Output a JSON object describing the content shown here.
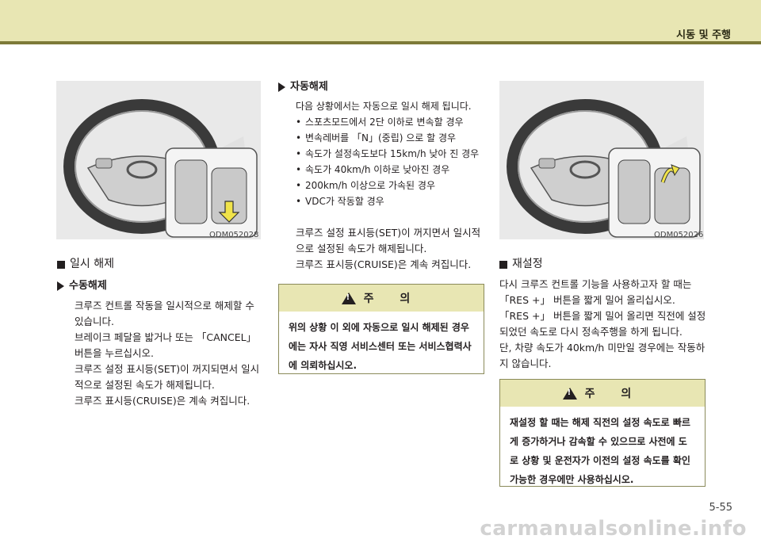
{
  "header": {
    "title": "시동 및 주행"
  },
  "figures": {
    "left_caption": "ODM052028",
    "right_caption": "ODM052026"
  },
  "left": {
    "section_title": "일시 해제",
    "sub_title": "수동해제",
    "paragraphs": [
      "크루즈 컨트롤 작동을 일시적으로 해제할 수 있습니다.",
      "브레이크 페달을 밟거나 또는 「CANCEL」 버튼을 누르십시오.",
      "크루즈 설정 표시등(SET)이 꺼지되면서 일시적으로 설정된 속도가 해제됩니다.",
      "크루즈 표시등(CRUISE)은 계속 켜집니다."
    ]
  },
  "middle": {
    "sub_title": "자동해제",
    "intro": "다음 상황에서는 자동으로 일시 해제 됩니다.",
    "bullets": [
      "스포츠모드에서 2단 이하로 변속할 경우",
      "변속레버를 「N」(중립) 으로 할 경우",
      "속도가 설정속도보다 15km/h 낮아 진 경우",
      "속도가 40km/h 이하로 낮아진 경우",
      "200km/h 이상으로 가속된 경우",
      "VDC가 작동할 경우"
    ],
    "paragraphs": [
      "크루즈 설정 표시등(SET)이 꺼지면서 일시적으로 설정된 속도가 해제됩니다.",
      "크루즈 표시등(CRUISE)은 계속 켜집니다."
    ],
    "caution_title": "주 의",
    "caution_text": "위의 상황 이 외에 자동으로 일시 해제된 경우에는 자사 직영 서비스센터 또는 서비스협력사에 의뢰하십시오."
  },
  "right": {
    "section_title": "재설정",
    "paragraphs": [
      "다시 크루즈 컨트롤 기능을 사용하고자 할 때는 「RES +」 버튼을 짧게 밀어 올리십시오.",
      "「RES +」 버튼을 짧게 밀어 올리면 직전에 설정되었던 속도로 다시 정속주행을 하게 됩니다.",
      "단, 차량 속도가 40km/h 미만일 경우에는 작동하지 않습니다."
    ],
    "caution_title": "주 의",
    "caution_text": "재설정 할 때는 해제 직전의 설정 속도로 빠르게 증가하거나 감속할 수 있으므로 사전에 도로 상황 및 운전자가 이전의 설정 속도를 확인 가능한 경우에만 사용하십시오."
  },
  "footer": {
    "page": "5-55",
    "watermark": "carmanualsonline.info"
  },
  "colors": {
    "header_band": "#e8e6b3",
    "header_line": "#7d7a38",
    "caution_head": "#e8e6b3"
  }
}
